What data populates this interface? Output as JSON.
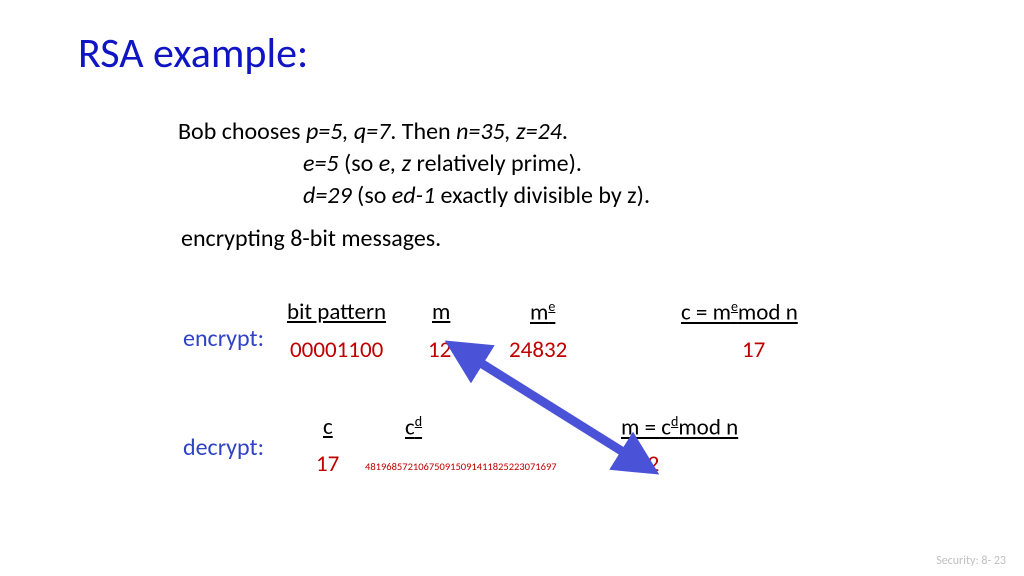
{
  "title": "RSA example:",
  "intro": {
    "line1_a": "Bob chooses ",
    "line1_b": "p=5, q=7",
    "line1_c": ".  Then ",
    "line1_d": "n=35, z=24",
    "line1_e": ".",
    "line2_a": "e=5",
    "line2_b": "  (so ",
    "line2_c": "e, z",
    "line2_d": "  relatively prime).",
    "line3_a": "d=29",
    "line3_b": " (so ",
    "line3_c": "ed-1",
    "line3_d": " exactly divisible by z).",
    "line4": "encrypting 8-bit messages."
  },
  "encrypt": {
    "label": "encrypt:",
    "headers": {
      "bit_pattern": "bit pattern",
      "m": "m",
      "me": "m",
      "me_sup": "e",
      "formula": "c = m",
      "formula_sup": "e",
      "formula_rest": "mod  n"
    },
    "values": {
      "bit_pattern": "00001100",
      "m": "12",
      "me": "24832",
      "c": "17"
    }
  },
  "decrypt": {
    "label": "decrypt:",
    "headers": {
      "c": "c",
      "cd": "c",
      "cd_sup": "d",
      "formula": "m = c",
      "formula_sup": "d",
      "formula_rest": "mod  n"
    },
    "values": {
      "c": "17",
      "cd": "481968572106750915091411825223071697",
      "m": "12"
    }
  },
  "footer": "Security: 8- 23"
}
